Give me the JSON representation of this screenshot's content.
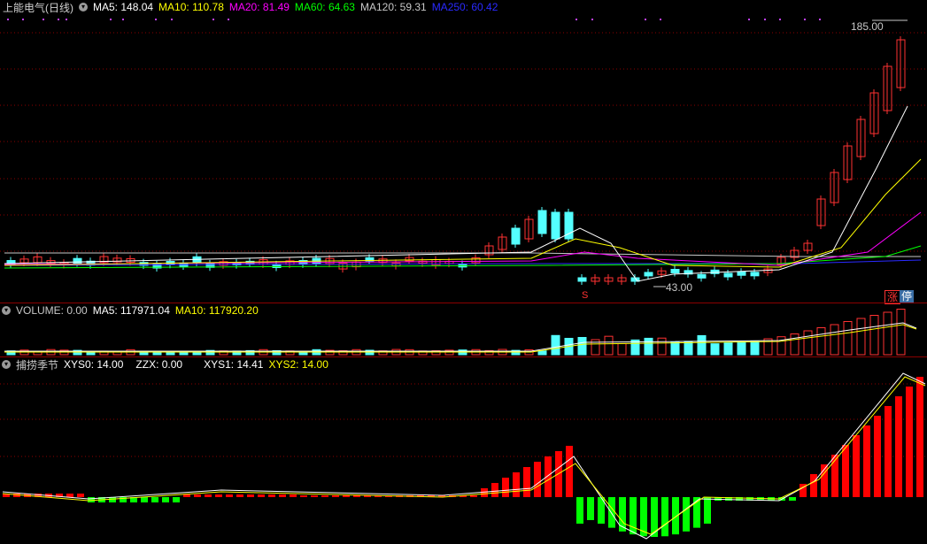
{
  "main_panel": {
    "title": "上能电气(日线)",
    "indicators": [
      {
        "label": "MA5: 148.04",
        "color": "#ffffff"
      },
      {
        "label": "MA10: 110.78",
        "color": "#ffff00"
      },
      {
        "label": "MA20: 81.49",
        "color": "#ff00ff"
      },
      {
        "label": "MA60: 64.63",
        "color": "#00ff00"
      },
      {
        "label": "MA120: 59.31",
        "color": "#c8c8c8"
      },
      {
        "label": "MA250: 60.42",
        "color": "#0000ff"
      }
    ],
    "high_label": "185.00",
    "low_label": "43.00",
    "signal_mark": "S",
    "badge_zhang": "涨",
    "badge_ting": "停"
  },
  "volume_panel": {
    "title": "VOLUME: 0.00",
    "indicators": [
      {
        "label": "MA5: 117971.04",
        "color": "#ffffff"
      },
      {
        "label": "MA10: 117920.20",
        "color": "#ffff00"
      }
    ]
  },
  "indicator_panel": {
    "title": "捕捞季节",
    "indicators": [
      {
        "label": "XYS0: 14.00",
        "color": "#ffffff"
      },
      {
        "label": "ZZX: 0.00",
        "color": "#ffffff"
      },
      {
        "label": "XYS1: 14.41",
        "color": "#ffffff"
      },
      {
        "label": "XYS2: 14.00",
        "color": "#ffff00"
      }
    ]
  },
  "colors": {
    "up": "#ff3232",
    "down": "#54ffff",
    "grid": "#8b0000",
    "osc_up": "#ff0000",
    "osc_down": "#00ff00"
  }
}
